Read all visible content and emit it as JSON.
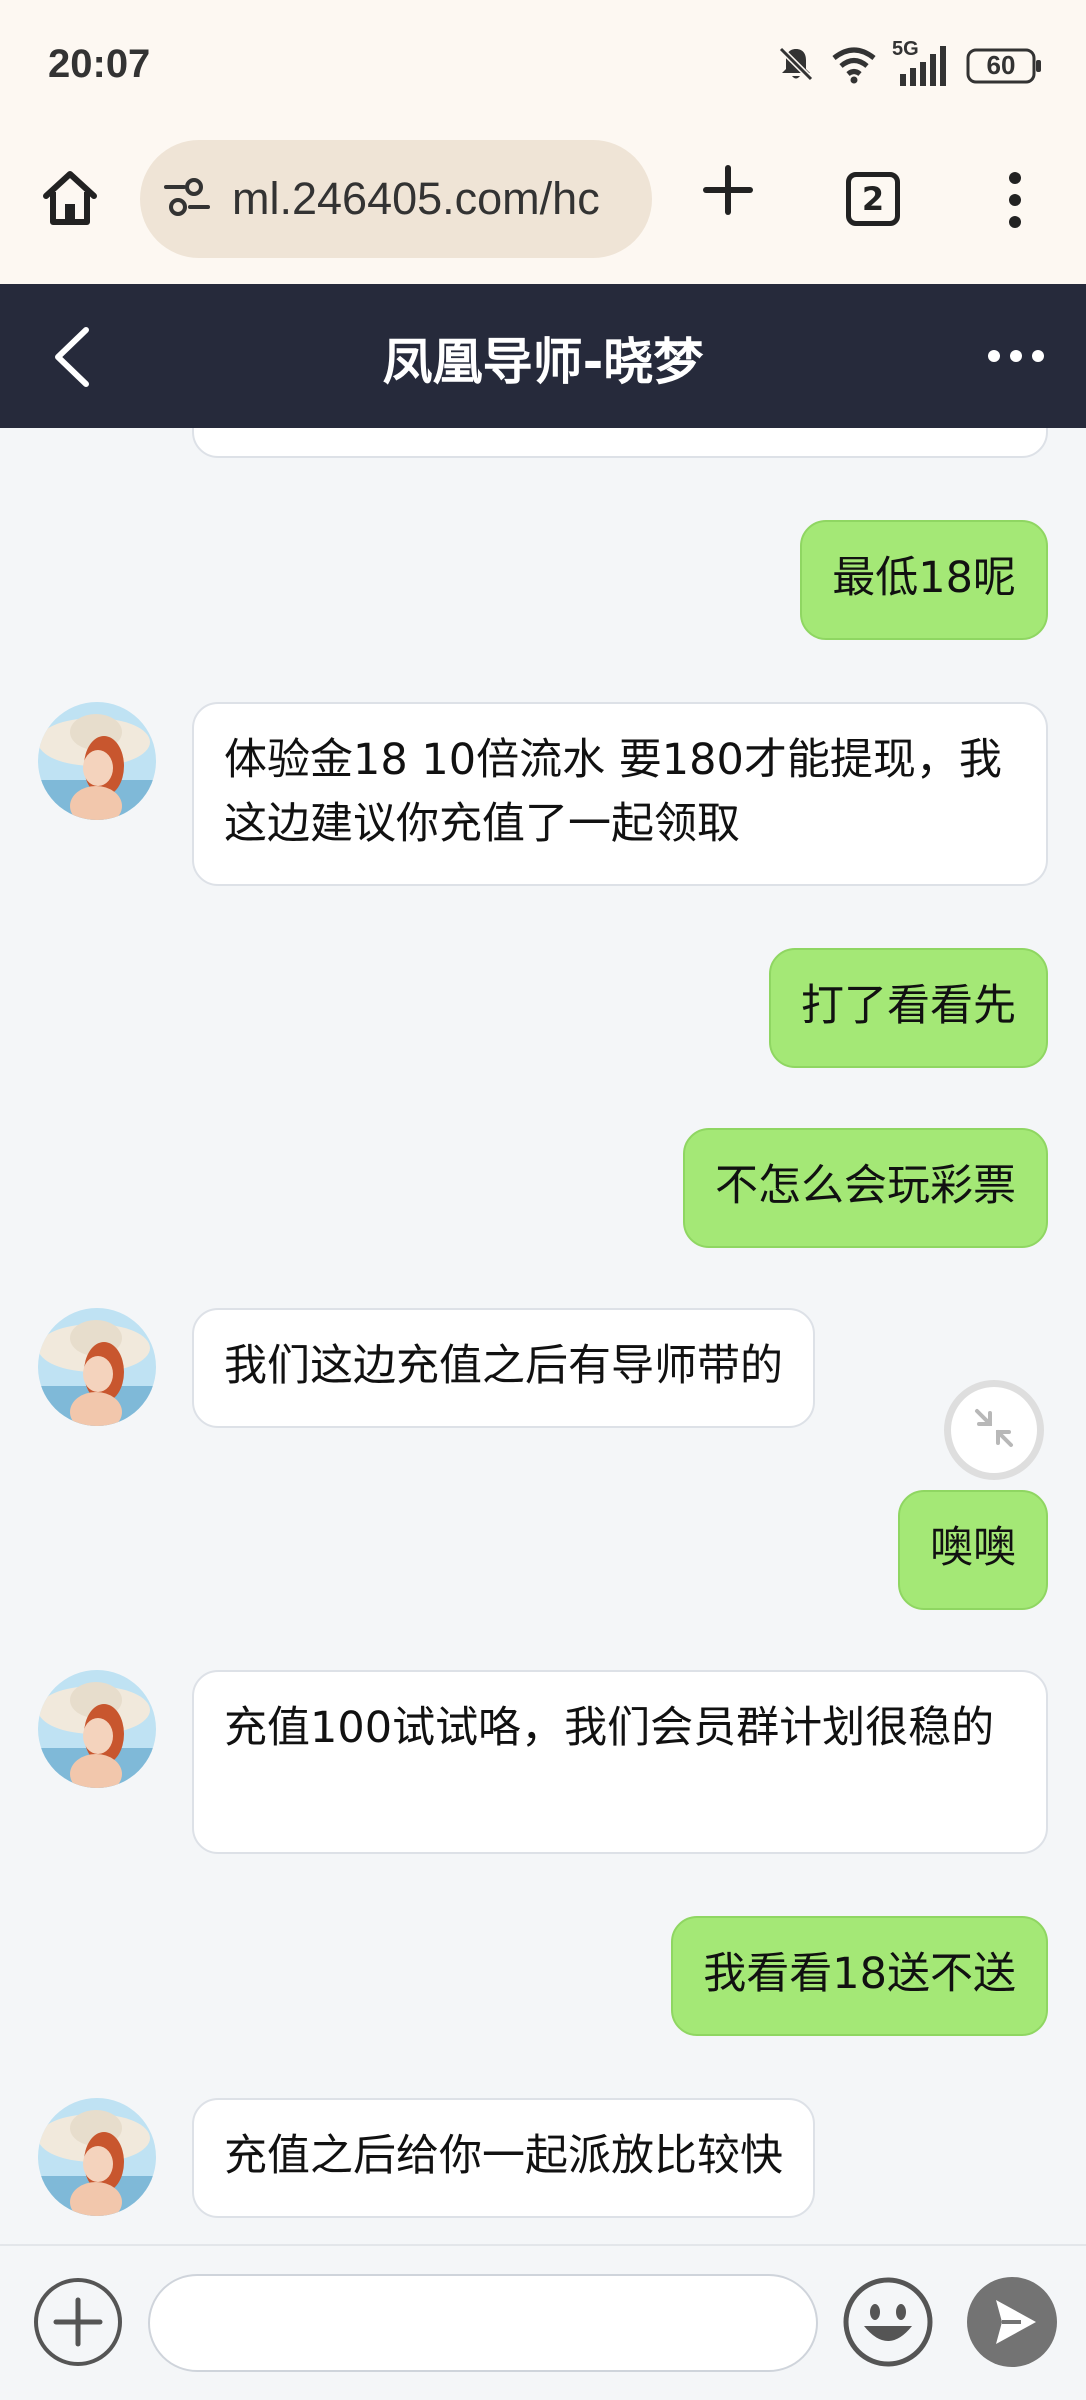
{
  "status_bar": {
    "time": "20:07",
    "network": "5G",
    "battery": "60",
    "icons": [
      "bell-off-icon",
      "wifi-icon",
      "signal-icon",
      "battery-icon"
    ]
  },
  "browser": {
    "url": "ml.246405.com/hc",
    "tab_count": "2",
    "icons": [
      "home-icon",
      "site-settings-icon",
      "plus-icon",
      "tab-switcher-icon",
      "more-vert-icon"
    ]
  },
  "chat": {
    "title": "凤凰导师-晓梦",
    "messages": [
      {
        "side": "out",
        "text": "最低18呢"
      },
      {
        "side": "in",
        "text": "体验金18 10倍流水 要180才能提现，我这边建议你充值了一起领取"
      },
      {
        "side": "out",
        "text": "打了看看先"
      },
      {
        "side": "out",
        "text": "不怎么会玩彩票"
      },
      {
        "side": "in",
        "text": "我们这边充值之后有导师带的"
      },
      {
        "side": "out",
        "text": "噢噢"
      },
      {
        "side": "in",
        "text": "充值100试试咯，我们会员群计划很稳的"
      },
      {
        "side": "out",
        "text": "我看看18送不送"
      },
      {
        "side": "in",
        "text": "充值之后给你一起派放比较快"
      }
    ]
  },
  "input_bar": {
    "placeholder": "",
    "icons": [
      "add-circle-icon",
      "emoji-icon",
      "send-icon"
    ]
  },
  "colors": {
    "header_bg": "#262a3b",
    "outgoing_bubble": "#a4e876",
    "incoming_bubble": "#ffffff",
    "chat_bg": "#f4f6f8",
    "browser_bg": "#fdf8f2",
    "url_pill": "#efe4d6"
  }
}
